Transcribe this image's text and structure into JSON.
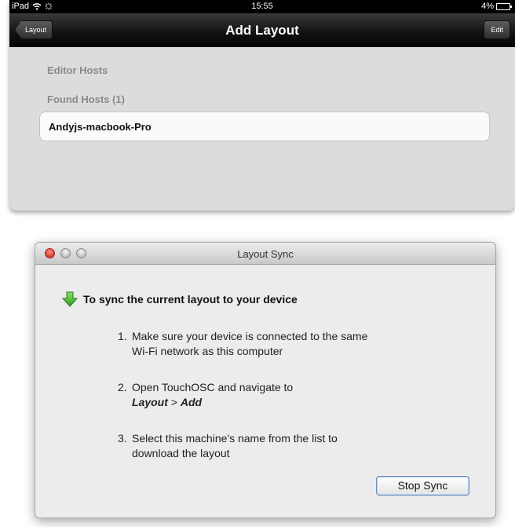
{
  "ipad": {
    "status": {
      "carrier": "iPad",
      "time": "15:55",
      "battery": "4%"
    },
    "nav": {
      "back_label": "Layout",
      "title": "Add Layout",
      "edit_label": "Edit"
    },
    "sections": {
      "editor_hosts": "Editor Hosts",
      "found_hosts": "Found Hosts (1)"
    },
    "hosts": [
      {
        "name": "Andyjs-macbook-Pro"
      }
    ]
  },
  "dialog": {
    "title": "Layout Sync",
    "heading": "To sync the current layout to your device",
    "steps": [
      {
        "num": "1.",
        "line1": "Make sure your device is connected to the same",
        "line2": "Wi-Fi network as this computer"
      },
      {
        "num": "2.",
        "line1": "Open TouchOSC and navigate to",
        "em_a": "Layout",
        "sep": " > ",
        "em_b": "Add"
      },
      {
        "num": "3.",
        "line1": "Select this machine's name from the list to",
        "line2": "download the layout"
      }
    ],
    "stop_label": "Stop Sync"
  },
  "icons": {
    "wifi": "wifi-icon",
    "activity": "spinner-icon",
    "battery": "battery-icon",
    "sync_arrow": "green-down-arrow-icon"
  },
  "colors": {
    "arrow_green": "#3fae2a",
    "close_red": "#e0443a"
  }
}
